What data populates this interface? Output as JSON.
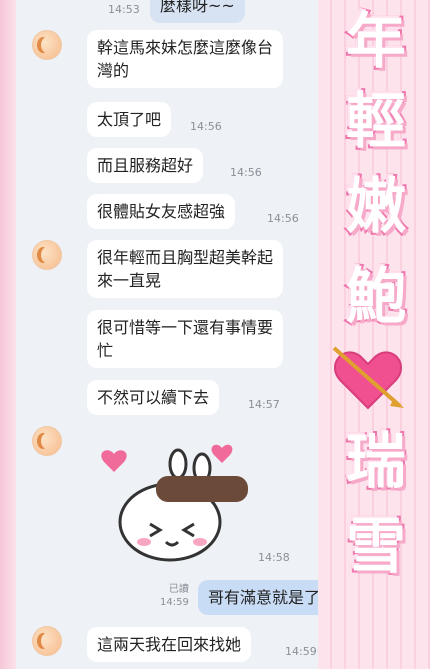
{
  "chat": {
    "top_bubble": {
      "text": "麼樣呀~~",
      "time": "14:53"
    },
    "messages": [
      {
        "text_line1": "幹這馬來妹怎麼這麼像台",
        "text_line2": "灣的"
      },
      {
        "text": "太頂了吧",
        "time": "14:56"
      },
      {
        "text": "而且服務超好",
        "time": "14:56"
      },
      {
        "text": "很體貼女友感超強",
        "time": "14:56"
      },
      {
        "text_line1": "很年輕而且胸型超美幹起",
        "text_line2": "來一直晃"
      },
      {
        "text_line1": "很可惜等一下還有事情要",
        "text_line2": "忙"
      },
      {
        "text": "不然可以續下去",
        "time": "14:57"
      }
    ],
    "sticker": {
      "name": "bunny-sticker",
      "time": "14:58"
    },
    "mine": {
      "text": "哥有滿意就是了",
      "read": "已讀",
      "time": "14:59"
    },
    "last": {
      "text": "這兩天我在回來找她",
      "time": "14:59"
    }
  },
  "decoration": {
    "chars": [
      "年",
      "輕",
      "嫩",
      "鮑",
      "瑞",
      "雪"
    ],
    "accent": "#ee77ad",
    "heart_color": "#f0508f"
  }
}
